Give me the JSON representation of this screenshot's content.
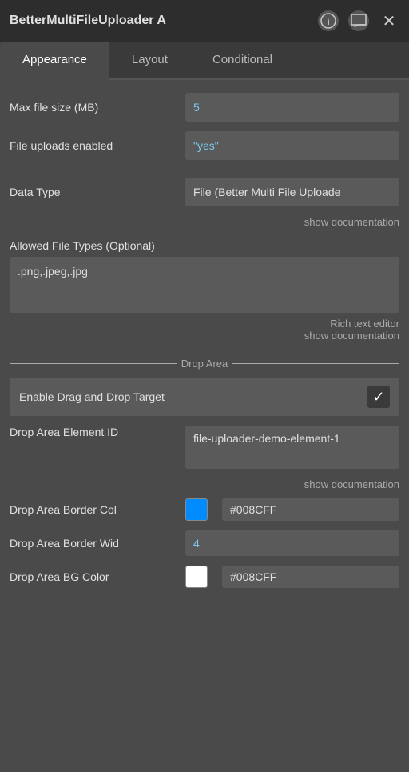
{
  "titleBar": {
    "title": "BetterMultiFileUploader A",
    "infoIcon": "ℹ",
    "chatIcon": "💬",
    "closeIcon": "✕"
  },
  "tabs": [
    {
      "id": "appearance",
      "label": "Appearance",
      "active": true
    },
    {
      "id": "layout",
      "label": "Layout",
      "active": false
    },
    {
      "id": "conditional",
      "label": "Conditional",
      "active": false
    }
  ],
  "fields": {
    "maxFileSize": {
      "label": "Max file size (MB)",
      "value": "5"
    },
    "fileUploadsEnabled": {
      "label": "File uploads enabled",
      "value": "\"yes\""
    },
    "dataType": {
      "label": "Data Type",
      "value": "File (Better Multi File Uploade",
      "showDoc": "show documentation"
    },
    "allowedFileTypes": {
      "label": "Allowed File Types (Optional)",
      "value": ".png,.jpeg,.jpg",
      "richText": "Rich text editor",
      "showDoc": "show documentation"
    }
  },
  "dropArea": {
    "sectionLabel": "Drop Area",
    "enableDragAndDrop": {
      "label": "Enable Drag and Drop Target",
      "checked": true
    },
    "elementID": {
      "label": "Drop Area Element ID",
      "value": "file-uploader-demo-element-1",
      "showDoc": "show documentation"
    },
    "borderColor": {
      "label": "Drop Area Border Col",
      "swatchColor": "#008CFF",
      "value": "#008CFF"
    },
    "borderWidth": {
      "label": "Drop Area Border Wid",
      "value": "4"
    },
    "bgColor": {
      "label": "Drop Area BG Color",
      "swatchColor": "#ffffff",
      "value": "#008CFF"
    }
  }
}
